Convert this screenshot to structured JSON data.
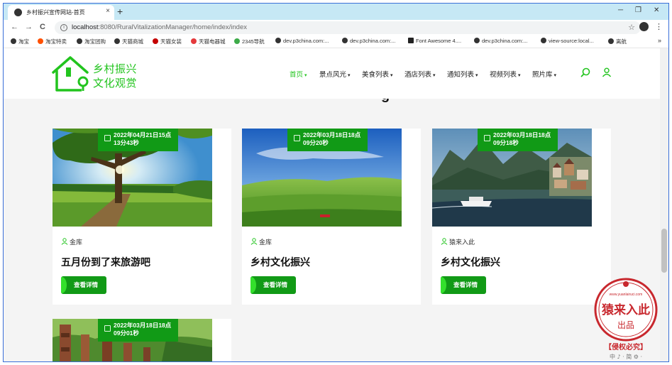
{
  "browser": {
    "tab_title": "乡村振兴宣传网站-首页",
    "tab_close": "×",
    "new_tab": "+",
    "url_host": "localhost",
    "url_rest": ":8080/RuralVitalizationManager/home/index/index",
    "minimize": "─",
    "restore": "❐",
    "close": "✕",
    "back": "←",
    "forward": "→",
    "reload": "C",
    "star": "☆",
    "menu": "⋮",
    "bookmarks_more": "»"
  },
  "bookmarks": [
    {
      "label": "淘宝",
      "color": "#333333"
    },
    {
      "label": "淘宝特卖",
      "color": "#ff5000"
    },
    {
      "label": "淘宝团购",
      "color": "#333333"
    },
    {
      "label": "天猫商城",
      "color": "#333333"
    },
    {
      "label": "天猫女装",
      "color": "#c40000"
    },
    {
      "label": "天猫电器城",
      "color": "#e4393c"
    },
    {
      "label": "2345导航",
      "color": "#3dab49"
    },
    {
      "label": "dev.p3china.com:...",
      "color": "#333333"
    },
    {
      "label": "dev.p3china.com:...",
      "color": "#333333"
    },
    {
      "label": "Font Awesome 4....",
      "color": "#222222"
    },
    {
      "label": "dev.p3china.com:...",
      "color": "#333333"
    },
    {
      "label": "view-source:local...",
      "color": "#333333"
    },
    {
      "label": "离航",
      "color": "#333333"
    }
  ],
  "site": {
    "logo_line1": "乡村振兴",
    "logo_line2": "文化观赏",
    "brand_color": "#22c41e",
    "badge_color": "#119a16",
    "nav": [
      {
        "label": "首页",
        "active": true
      },
      {
        "label": "景点风光",
        "active": false
      },
      {
        "label": "美食列表",
        "active": false
      },
      {
        "label": "酒店列表",
        "active": false
      },
      {
        "label": "通知列表",
        "active": false
      },
      {
        "label": "视频列表",
        "active": false
      },
      {
        "label": "照片库",
        "active": false
      }
    ],
    "nav_caret": "⌄",
    "partial_heading": "g"
  },
  "cards": [
    {
      "date_line1": "2022年04月21日15点",
      "date_line2": "13分43秒",
      "author": "金库",
      "title": "五月份到了来旅游吧",
      "button": "查看详情",
      "image": "tree-sunburst-meadow"
    },
    {
      "date_line1": "2022年03月18日18点",
      "date_line2": "09分20秒",
      "author": "金库",
      "title": "乡村文化振兴",
      "button": "查看详情",
      "image": "green-grassland-blue-sky"
    },
    {
      "date_line1": "2022年03月18日18点",
      "date_line2": "09分18秒",
      "author": "猿来入此",
      "title": "乡村文化振兴",
      "button": "查看详情",
      "image": "lake-village-mountains"
    },
    {
      "date_line1": "2022年03月18日18点",
      "date_line2": "09分01秒",
      "author": "",
      "title": "",
      "button": "",
      "image": "forest-totems"
    }
  ],
  "watermark": {
    "seal_main": "猿来入此",
    "seal_sub": "出品",
    "seal_url": "www.yuanlairuci.com",
    "banner": "【侵权必究】",
    "footer": "中 ♪ · 简 ⚙ ·"
  }
}
